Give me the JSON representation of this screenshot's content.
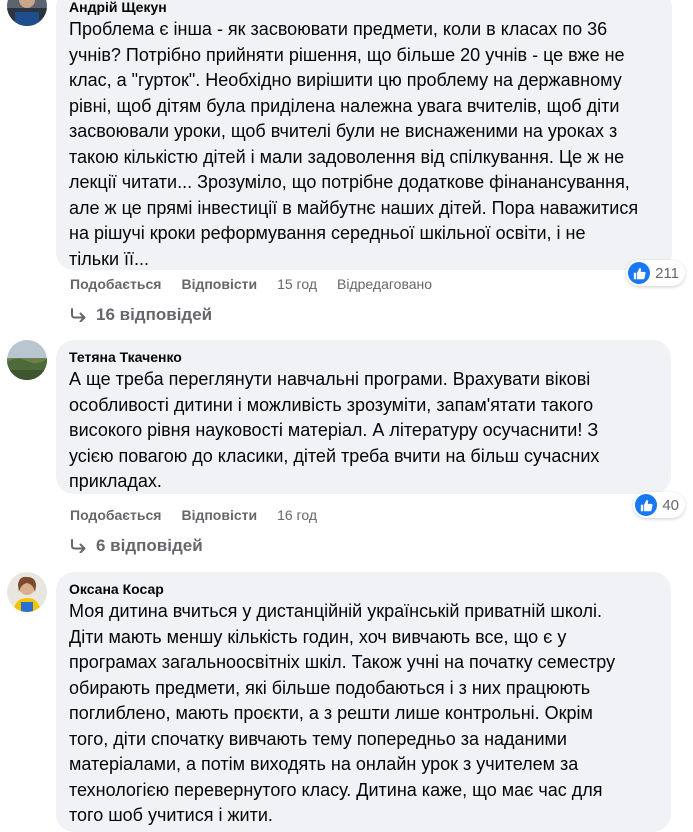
{
  "colors": {
    "bubble": "#f0f2f5",
    "meta_text": "#65676b",
    "like_blue": "#1877f2"
  },
  "comments": [
    {
      "author": "Андрій Щекун",
      "text": "Проблема є інша - як засвоювати предмети, коли в класах по 36\nучнів? Потрібно прийняти рішення, що більше 20 учнів - це вже не\nклас, а \"гурток\". Необхідно вирішити цю проблему на державному\nрівні, щоб дітям була приділена належна увага вчителів, щоб діти\nзасвоювали уроки, щоб вчителі були не виснаженими на уроках з\nтакою кількістю дітей і мали задоволення від спілкування. Це ж не\nлекції читати... Зрозуміло, що потрібне додаткове фінанансування,\nале ж це прямі інвестиції в майбутнє наших дітей. Пора наважитися\nна рішучі кроки реформування середньої шкільної освіти, і не\nтільки її...",
      "reactions": "211",
      "reaction_icon": "like-icon",
      "like_label": "Подобається",
      "reply_label": "Відповісти",
      "time": "15 год",
      "edited": "Відредаговано",
      "replies": "16 відповідей"
    },
    {
      "author": "Тетяна Ткаченко",
      "text": "А ще треба переглянути навчальні програми. Врахувати вікові\nособливості дитини і можливість зрозуміти, запам'ятати такого\nвисокого рівня науковості матеріал. А літературу осучаснити! З\nусією повагою до класики, дітей треба вчити на більш сучасних\nприкладах.",
      "reactions": "40",
      "reaction_icon": "like-icon",
      "like_label": "Подобається",
      "reply_label": "Відповісти",
      "time": "16 год",
      "replies": "6 відповідей"
    },
    {
      "author": "Оксана Косар",
      "text": "Моя дитина вчиться у дистанційній українській приватній школі.\nДіти мають меншу кількість годин, хоч вивчають все, що є у\nпрограмах загальноосвітніх шкіл. Також учні на початку семестру\nобирають предмети, які більше подобаються і з них працюють\nпоглиблено, мають проєкти, а з решти лише контрольні. Окрім\nтого, діти спочатку вивчають тему попередньо за наданими\nматеріалами, а потім виходять на онлайн урок з учителем за\nтехнологією перевернутого класу. Дитина каже, що має час для\nтого шоб учитися і жити."
    }
  ]
}
